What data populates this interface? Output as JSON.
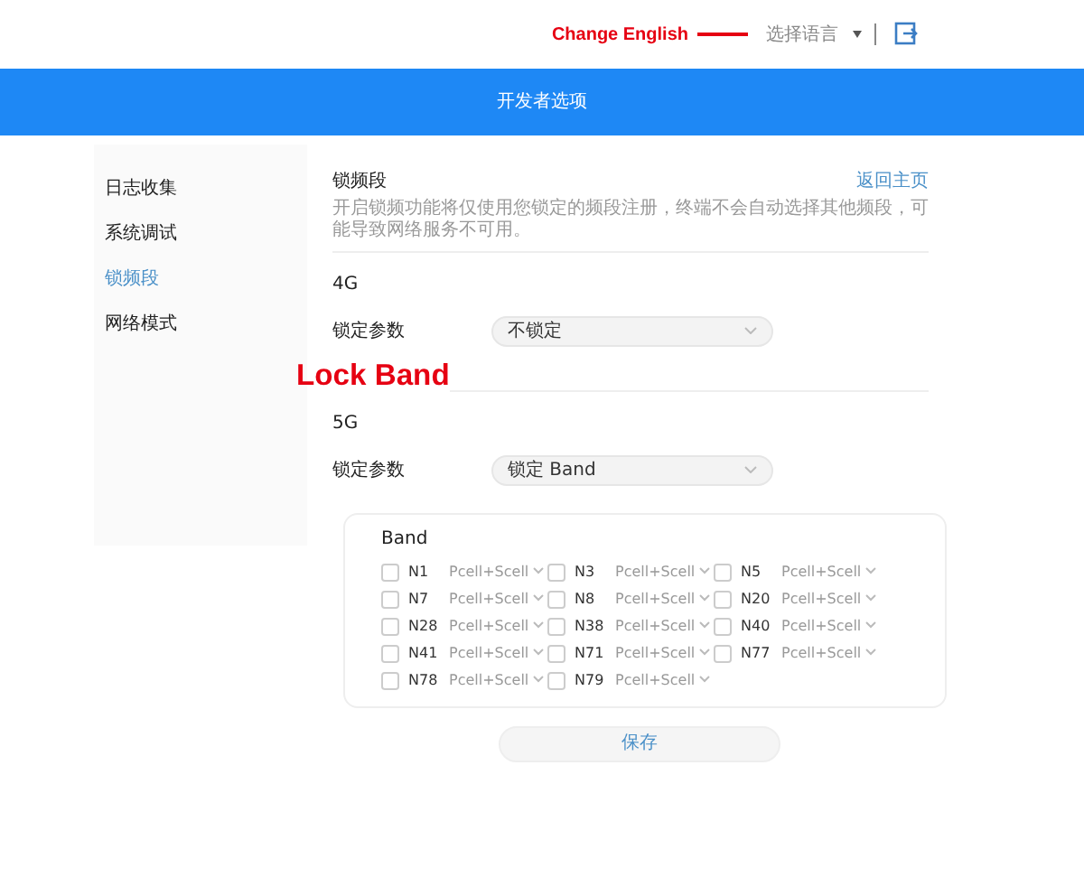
{
  "header": {
    "language_menu": "选择语言",
    "annotation": "Change English"
  },
  "title_bar": {
    "title": "开发者选项"
  },
  "sidebar": {
    "items": [
      {
        "label": "日志收集",
        "selected": false
      },
      {
        "label": "系统调试",
        "selected": false
      },
      {
        "label": "锁频段",
        "selected": true
      },
      {
        "label": "网络模式",
        "selected": false
      }
    ]
  },
  "content": {
    "title": "锁频段",
    "back_link": "返回主页",
    "description": "开启锁频功能将仅使用您锁定的频段注册，终端不会自动选择其他频段，可能导致网络服务不可用。",
    "annotation": "Lock Band",
    "sections": [
      {
        "heading": "4G",
        "field_label": "锁定参数",
        "value": "不锁定"
      },
      {
        "heading": "5G",
        "field_label": "锁定参数",
        "value": "锁定 Band"
      }
    ],
    "band_panel": {
      "title": "Band",
      "bands": [
        {
          "label": "N1",
          "checked": false,
          "mode": "Pcell+Scell"
        },
        {
          "label": "N3",
          "checked": false,
          "mode": "Pcell+Scell"
        },
        {
          "label": "N5",
          "checked": false,
          "mode": "Pcell+Scell"
        },
        {
          "label": "N7",
          "checked": false,
          "mode": "Pcell+Scell"
        },
        {
          "label": "N8",
          "checked": false,
          "mode": "Pcell+Scell"
        },
        {
          "label": "N20",
          "checked": false,
          "mode": "Pcell+Scell"
        },
        {
          "label": "N28",
          "checked": false,
          "mode": "Pcell+Scell"
        },
        {
          "label": "N38",
          "checked": false,
          "mode": "Pcell+Scell"
        },
        {
          "label": "N40",
          "checked": false,
          "mode": "Pcell+Scell"
        },
        {
          "label": "N41",
          "checked": false,
          "mode": "Pcell+Scell"
        },
        {
          "label": "N71",
          "checked": false,
          "mode": "Pcell+Scell"
        },
        {
          "label": "N77",
          "checked": false,
          "mode": "Pcell+Scell"
        },
        {
          "label": "N78",
          "checked": false,
          "mode": "Pcell+Scell"
        },
        {
          "label": "N79",
          "checked": false,
          "mode": "Pcell+Scell"
        }
      ]
    },
    "save_button": "保存"
  }
}
